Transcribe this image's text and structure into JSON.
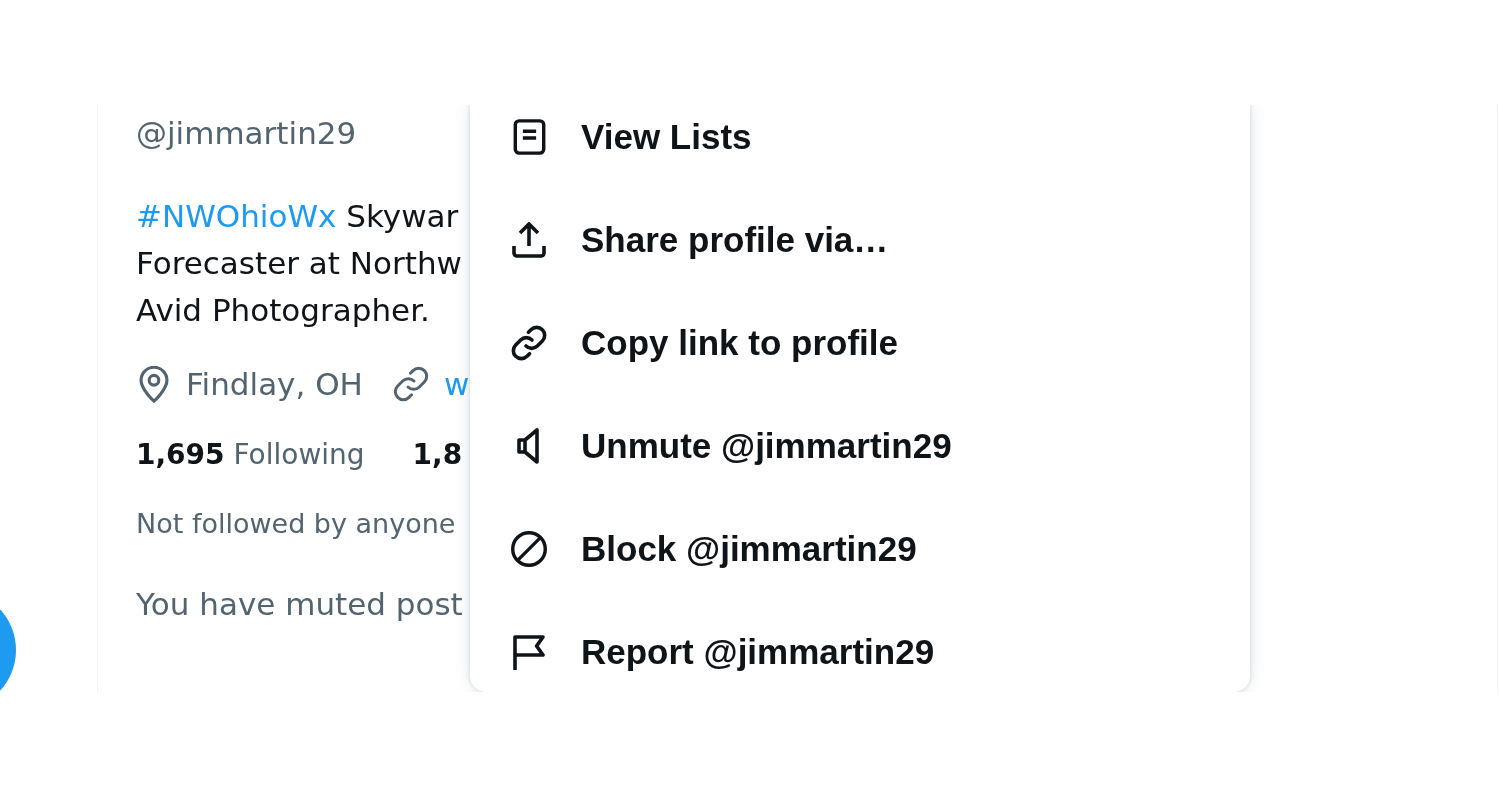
{
  "profile": {
    "handle": "@jimmartin29",
    "bio": {
      "hashtag": "#NWOhioWx",
      "lines": [
        "Skywar",
        "Forecaster at Northw",
        "Avid Photographer."
      ]
    },
    "location": "Findlay, OH",
    "website": "w",
    "stats": [
      {
        "count": "1,695",
        "label": "Following"
      },
      {
        "count": "1,8"
      }
    ],
    "followed_by": "Not followed by anyone",
    "muted_notice": "You have muted post"
  },
  "menu": {
    "items": [
      {
        "kind": "lists",
        "label": "View Lists"
      },
      {
        "kind": "share",
        "label": "Share profile via…"
      },
      {
        "kind": "link",
        "label": "Copy link to profile"
      },
      {
        "kind": "unmute",
        "label": "Unmute @jimmartin29"
      },
      {
        "kind": "block",
        "label": "Block @jimmartin29"
      },
      {
        "kind": "report",
        "label": "Report @jimmartin29"
      }
    ]
  }
}
